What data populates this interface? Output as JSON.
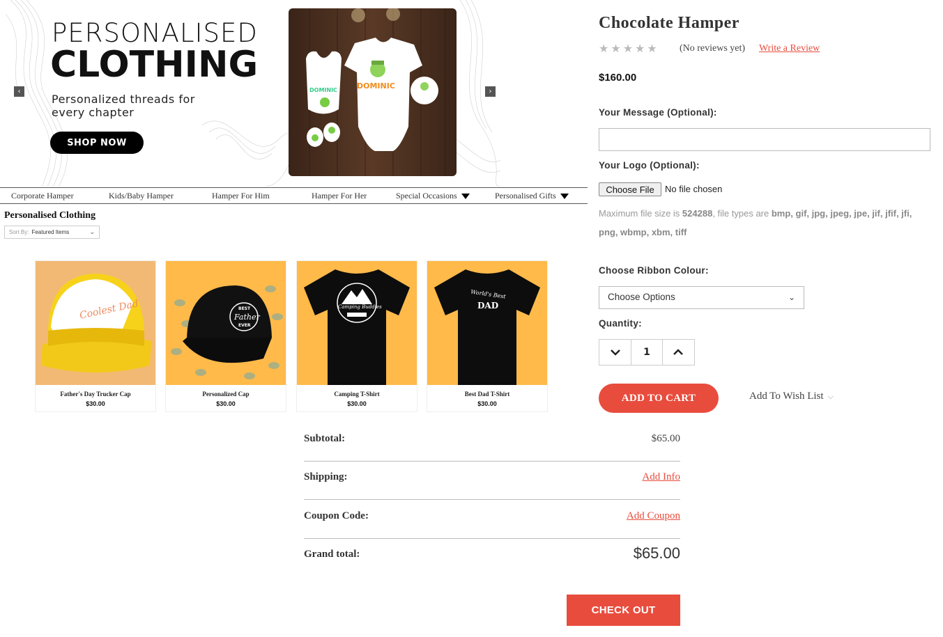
{
  "hero": {
    "title_line1": "PERSONALISED",
    "title_line2": "CLOTHING",
    "subtitle": "Personalized threads for every chapter",
    "cta": "SHOP NOW",
    "prev_arrow": "‹",
    "next_arrow": "›",
    "baby_name": "DOMINIC"
  },
  "nav": {
    "items": [
      "Corporate Hamper",
      "Kids/Baby Hamper",
      "Hamper For Him",
      "Hamper For Her",
      "Special Occasions",
      "Personalised Gifts"
    ]
  },
  "category": {
    "title": "Personalised Clothing",
    "sort_label": "Sort By:",
    "sort_value": "Featured Items"
  },
  "products": [
    {
      "name": "Father's Day Trucker Cap",
      "price": "$30.00"
    },
    {
      "name": "Personalized Cap",
      "price": "$30.00"
    },
    {
      "name": "Camping T-Shirt",
      "price": "$30.00"
    },
    {
      "name": "Best Dad T-Shirt",
      "price": "$30.00"
    }
  ],
  "product_print": {
    "cap1_text": "Coolest Dad",
    "cap2_line1": "BEST",
    "cap2_line2": "Father",
    "cap2_line3": "EVER",
    "tee1_text": "Camping Buddies",
    "tee2_line1": "World's Best",
    "tee2_line2": "DAD"
  },
  "detail": {
    "title": "Chocolate Hamper",
    "stars": "★★★★★",
    "reviews_text": "(No reviews yet)",
    "write_review": "Write a Review",
    "price": "$160.00",
    "message_label": "Your Message (Optional):",
    "logo_label": "Your Logo (Optional):",
    "choose_file": "Choose File",
    "no_file": "No file chosen",
    "file_note_prefix": "Maximum file size is ",
    "file_size": "524288",
    "file_note_mid": ", file types are ",
    "file_types": "bmp, gif, jpg, jpeg, jpe, jif, jfif, jfi, png, wbmp, xbm, tiff",
    "ribbon_label": "Choose Ribbon Colour:",
    "ribbon_value": "Choose Options",
    "quantity_label": "Quantity:",
    "quantity": "1",
    "add_to_cart": "ADD TO CART",
    "wishlist": "Add To Wish List"
  },
  "totals": {
    "subtotal_label": "Subtotal:",
    "subtotal": "$65.00",
    "shipping_label": "Shipping:",
    "shipping_link": "Add Info",
    "coupon_label": "Coupon Code:",
    "coupon_link": "Add Coupon",
    "grand_label": "Grand total:",
    "grand": "$65.00",
    "checkout": "CHECK OUT"
  },
  "colors": {
    "accent": "#e84c3d",
    "card_bg_orange": "#ffba4a",
    "card_bg_peach": "#f2b974"
  }
}
